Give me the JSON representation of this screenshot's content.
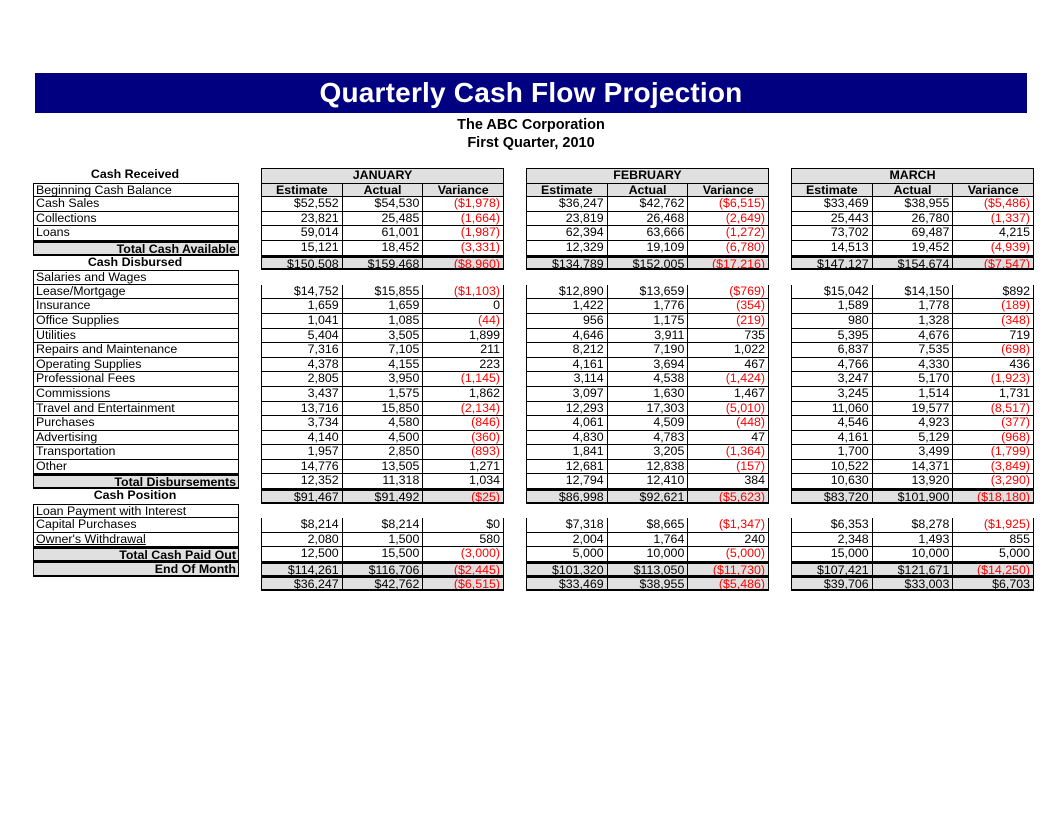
{
  "banner": {
    "title": "Quarterly Cash Flow Projection",
    "company": "The ABC Corporation",
    "period": "First Quarter, 2010",
    "background_color": "#000080",
    "text_color": "#FFFFFF"
  },
  "style": {
    "negative_color": "#FF0000",
    "total_fill": "#E0E0E0",
    "header_fill": "#E0E0E0"
  },
  "months": [
    "JANUARY",
    "FEBRUARY",
    "MARCH"
  ],
  "column_headers": [
    "Estimate",
    "Actual",
    "Variance"
  ],
  "sections": [
    {
      "title": "Cash Received",
      "rows": [
        {
          "label": "Beginning Cash Balance",
          "jan": [
            "$52,552",
            "$54,530",
            "($1,978)"
          ],
          "feb": [
            "$36,247",
            "$42,762",
            "($6,515)"
          ],
          "mar": [
            "$33,469",
            "$38,955",
            "($5,486)"
          ],
          "neg": [
            false,
            false,
            true,
            false,
            false,
            true,
            false,
            false,
            true
          ]
        },
        {
          "label": "Cash Sales",
          "jan": [
            "23,821",
            "25,485",
            "(1,664)"
          ],
          "feb": [
            "23,819",
            "26,468",
            "(2,649)"
          ],
          "mar": [
            "25,443",
            "26,780",
            "(1,337)"
          ],
          "neg": [
            false,
            false,
            true,
            false,
            false,
            true,
            false,
            false,
            true
          ]
        },
        {
          "label": "Collections",
          "jan": [
            "59,014",
            "61,001",
            "(1,987)"
          ],
          "feb": [
            "62,394",
            "63,666",
            "(1,272)"
          ],
          "mar": [
            "73,702",
            "69,487",
            "4,215"
          ],
          "neg": [
            false,
            false,
            true,
            false,
            false,
            true,
            false,
            false,
            false
          ]
        },
        {
          "label": "Loans",
          "jan": [
            "15,121",
            "18,452",
            "(3,331)"
          ],
          "feb": [
            "12,329",
            "19,109",
            "(6,780)"
          ],
          "mar": [
            "14,513",
            "19,452",
            "(4,939)"
          ],
          "neg": [
            false,
            false,
            true,
            false,
            false,
            true,
            false,
            false,
            true
          ]
        }
      ],
      "total": {
        "label": "Total Cash Available",
        "jan": [
          "$150,508",
          "$159,468",
          "($8,960)"
        ],
        "feb": [
          "$134,789",
          "$152,005",
          "($17,216)"
        ],
        "mar": [
          "$147,127",
          "$154,674",
          "($7,547)"
        ],
        "neg": [
          false,
          false,
          true,
          false,
          false,
          true,
          false,
          false,
          true
        ]
      }
    },
    {
      "title": "Cash Disbursed",
      "rows": [
        {
          "label": "Salaries and Wages",
          "jan": [
            "$14,752",
            "$15,855",
            "($1,103)"
          ],
          "feb": [
            "$12,890",
            "$13,659",
            "($769)"
          ],
          "mar": [
            "$15,042",
            "$14,150",
            "$892"
          ],
          "neg": [
            false,
            false,
            true,
            false,
            false,
            true,
            false,
            false,
            false
          ]
        },
        {
          "label": "Lease/Mortgage",
          "jan": [
            "1,659",
            "1,659",
            "0"
          ],
          "feb": [
            "1,422",
            "1,776",
            "(354)"
          ],
          "mar": [
            "1,589",
            "1,778",
            "(189)"
          ],
          "neg": [
            false,
            false,
            false,
            false,
            false,
            true,
            false,
            false,
            true
          ]
        },
        {
          "label": "Insurance",
          "jan": [
            "1,041",
            "1,085",
            "(44)"
          ],
          "feb": [
            "956",
            "1,175",
            "(219)"
          ],
          "mar": [
            "980",
            "1,328",
            "(348)"
          ],
          "neg": [
            false,
            false,
            true,
            false,
            false,
            true,
            false,
            false,
            true
          ]
        },
        {
          "label": "Office Supplies",
          "jan": [
            "5,404",
            "3,505",
            "1,899"
          ],
          "feb": [
            "4,646",
            "3,911",
            "735"
          ],
          "mar": [
            "5,395",
            "4,676",
            "719"
          ],
          "neg": [
            false,
            false,
            false,
            false,
            false,
            false,
            false,
            false,
            false
          ]
        },
        {
          "label": "Utilities",
          "jan": [
            "7,316",
            "7,105",
            "211"
          ],
          "feb": [
            "8,212",
            "7,190",
            "1,022"
          ],
          "mar": [
            "6,837",
            "7,535",
            "(698)"
          ],
          "neg": [
            false,
            false,
            false,
            false,
            false,
            false,
            false,
            false,
            true
          ]
        },
        {
          "label": "Repairs and Maintenance",
          "jan": [
            "4,378",
            "4,155",
            "223"
          ],
          "feb": [
            "4,161",
            "3,694",
            "467"
          ],
          "mar": [
            "4,766",
            "4,330",
            "436"
          ],
          "neg": [
            false,
            false,
            false,
            false,
            false,
            false,
            false,
            false,
            false
          ]
        },
        {
          "label": "Operating Supplies",
          "jan": [
            "2,805",
            "3,950",
            "(1,145)"
          ],
          "feb": [
            "3,114",
            "4,538",
            "(1,424)"
          ],
          "mar": [
            "3,247",
            "5,170",
            "(1,923)"
          ],
          "neg": [
            false,
            false,
            true,
            false,
            false,
            true,
            false,
            false,
            true
          ]
        },
        {
          "label": "Professional Fees",
          "jan": [
            "3,437",
            "1,575",
            "1,862"
          ],
          "feb": [
            "3,097",
            "1,630",
            "1,467"
          ],
          "mar": [
            "3,245",
            "1,514",
            "1,731"
          ],
          "neg": [
            false,
            false,
            false,
            false,
            false,
            false,
            false,
            false,
            false
          ]
        },
        {
          "label": "Commissions",
          "jan": [
            "13,716",
            "15,850",
            "(2,134)"
          ],
          "feb": [
            "12,293",
            "17,303",
            "(5,010)"
          ],
          "mar": [
            "11,060",
            "19,577",
            "(8,517)"
          ],
          "neg": [
            false,
            false,
            true,
            false,
            false,
            true,
            false,
            false,
            true
          ]
        },
        {
          "label": "Travel and Entertainment",
          "jan": [
            "3,734",
            "4,580",
            "(846)"
          ],
          "feb": [
            "4,061",
            "4,509",
            "(448)"
          ],
          "mar": [
            "4,546",
            "4,923",
            "(377)"
          ],
          "neg": [
            false,
            false,
            true,
            false,
            false,
            true,
            false,
            false,
            true
          ]
        },
        {
          "label": "Purchases",
          "jan": [
            "4,140",
            "4,500",
            "(360)"
          ],
          "feb": [
            "4,830",
            "4,783",
            "47"
          ],
          "mar": [
            "4,161",
            "5,129",
            "(968)"
          ],
          "neg": [
            false,
            false,
            true,
            false,
            false,
            false,
            false,
            false,
            true
          ]
        },
        {
          "label": "Advertising",
          "jan": [
            "1,957",
            "2,850",
            "(893)"
          ],
          "feb": [
            "1,841",
            "3,205",
            "(1,364)"
          ],
          "mar": [
            "1,700",
            "3,499",
            "(1,799)"
          ],
          "neg": [
            false,
            false,
            true,
            false,
            false,
            true,
            false,
            false,
            true
          ]
        },
        {
          "label": "Transportation",
          "jan": [
            "14,776",
            "13,505",
            "1,271"
          ],
          "feb": [
            "12,681",
            "12,838",
            "(157)"
          ],
          "mar": [
            "10,522",
            "14,371",
            "(3,849)"
          ],
          "neg": [
            false,
            false,
            false,
            false,
            false,
            true,
            false,
            false,
            true
          ]
        },
        {
          "label": "Other",
          "jan": [
            "12,352",
            "11,318",
            "1,034"
          ],
          "feb": [
            "12,794",
            "12,410",
            "384"
          ],
          "mar": [
            "10,630",
            "13,920",
            "(3,290)"
          ],
          "neg": [
            false,
            false,
            false,
            false,
            false,
            false,
            false,
            false,
            true
          ]
        }
      ],
      "total": {
        "label": "Total Disbursements",
        "jan": [
          "$91,467",
          "$91,492",
          "($25)"
        ],
        "feb": [
          "$86,998",
          "$92,621",
          "($5,623)"
        ],
        "mar": [
          "$83,720",
          "$101,900",
          "($18,180)"
        ],
        "neg": [
          false,
          false,
          true,
          false,
          false,
          true,
          false,
          false,
          true
        ]
      }
    },
    {
      "title": "Cash Position",
      "rows": [
        {
          "label": "Loan Payment with Interest",
          "jan": [
            "$8,214",
            "$8,214",
            "$0"
          ],
          "feb": [
            "$7,318",
            "$8,665",
            "($1,347)"
          ],
          "mar": [
            "$6,353",
            "$8,278",
            "($1,925)"
          ],
          "neg": [
            false,
            false,
            false,
            false,
            false,
            true,
            false,
            false,
            true
          ]
        },
        {
          "label": "Capital Purchases",
          "jan": [
            "2,080",
            "1,500",
            "580"
          ],
          "feb": [
            "2,004",
            "1,764",
            "240"
          ],
          "mar": [
            "2,348",
            "1,493",
            "855"
          ],
          "neg": [
            false,
            false,
            false,
            false,
            false,
            false,
            false,
            false,
            false
          ]
        },
        {
          "label": "Owner's Withdrawal",
          "underline": true,
          "jan": [
            "12,500",
            "15,500",
            "(3,000)"
          ],
          "feb": [
            "5,000",
            "10,000",
            "(5,000)"
          ],
          "mar": [
            "15,000",
            "10,000",
            "5,000"
          ],
          "neg": [
            false,
            false,
            true,
            false,
            false,
            true,
            false,
            false,
            false
          ]
        }
      ],
      "total": {
        "label": "Total Cash Paid Out",
        "jan": [
          "$114,261",
          "$116,706",
          "($2,445)"
        ],
        "feb": [
          "$101,320",
          "$113,050",
          "($11,730)"
        ],
        "mar": [
          "$107,421",
          "$121,671",
          "($14,250)"
        ],
        "neg": [
          false,
          false,
          true,
          false,
          false,
          true,
          false,
          false,
          true
        ]
      },
      "grand_total": {
        "label": "End Of Month",
        "jan": [
          "$36,247",
          "$42,762",
          "($6,515)"
        ],
        "feb": [
          "$33,469",
          "$38,955",
          "($5,486)"
        ],
        "mar": [
          "$39,706",
          "$33,003",
          "$6,703"
        ],
        "neg": [
          false,
          false,
          true,
          false,
          false,
          true,
          false,
          false,
          false
        ]
      }
    }
  ]
}
